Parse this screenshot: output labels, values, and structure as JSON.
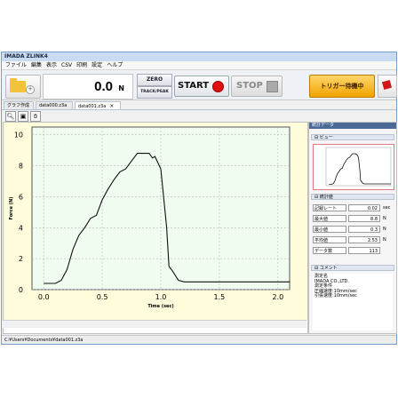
{
  "window": {
    "title": "IMADA ZLINK4"
  },
  "menu": [
    "ファイル",
    "編集",
    "表示",
    "CSV",
    "印刷",
    "設定",
    "ヘルプ"
  ],
  "toolbar": {
    "force_value": "0.0",
    "force_unit": "N",
    "zero_label": "ZERO",
    "trackpeak_label": "TRACK/PEAK",
    "start_label": "START",
    "stop_label": "STOP",
    "trigger_label": "トリガー待機中"
  },
  "tabs": [
    {
      "label": "グラフ作成",
      "active": false
    },
    {
      "label": "data000.z3a",
      "active": false
    },
    {
      "label": "data001.z3a",
      "active": true,
      "close": "×"
    }
  ],
  "chart_data": {
    "type": "line",
    "xlabel": "Time (sec)",
    "ylabel": "Force (N)",
    "xlim": [
      -0.1,
      2.1
    ],
    "ylim": [
      0,
      10.5
    ],
    "xticks": [
      "0.0",
      "0.5",
      "1.0",
      "1.5",
      "2.0"
    ],
    "yticks": [
      "0",
      "2",
      "4",
      "6",
      "8",
      "10"
    ],
    "grid": true,
    "series": [
      {
        "x": [
          0.0,
          0.1,
          0.15,
          0.2,
          0.25,
          0.3,
          0.35,
          0.4,
          0.45,
          0.5,
          0.55,
          0.6,
          0.65,
          0.7,
          0.75,
          0.8,
          0.85,
          0.9,
          0.93,
          0.95,
          1.0,
          1.03,
          1.05,
          1.07,
          1.1,
          1.15,
          1.2,
          1.3,
          1.5,
          1.8,
          2.1
        ],
        "y": [
          0.4,
          0.4,
          0.6,
          1.3,
          2.6,
          3.5,
          4.0,
          4.6,
          4.8,
          5.8,
          6.5,
          7.1,
          7.6,
          7.8,
          8.3,
          8.8,
          8.8,
          8.8,
          8.5,
          8.6,
          7.8,
          5.5,
          4.0,
          1.5,
          1.2,
          0.6,
          0.5,
          0.5,
          0.5,
          0.5,
          0.5
        ]
      }
    ],
    "line_color": "#111111",
    "plot_bg": "#f0fcef",
    "outer_bg": "#fffcdc"
  },
  "right_panel": {
    "header": "統計データ",
    "preview_label": "ビュー",
    "stats_label": "統計値",
    "stats": [
      {
        "label": "記録レート",
        "value": "0.02",
        "unit": "sec"
      },
      {
        "label": "最大値",
        "value": "8.8",
        "unit": "N"
      },
      {
        "label": "最小値",
        "value": "0.3",
        "unit": "N"
      },
      {
        "label": "平均値",
        "value": "2.53",
        "unit": "N"
      },
      {
        "label": "データ数",
        "value": "113",
        "unit": ""
      }
    ],
    "comment_label": "コメント",
    "comment_text": "測定名\nIMADA CO.,LTD.\n測定条件\n圧縮速度:10mm/sec\n引張速度:10mm/sec"
  },
  "statusbar": {
    "path": "C:¥Users¥Documents¥data001.z3a"
  }
}
